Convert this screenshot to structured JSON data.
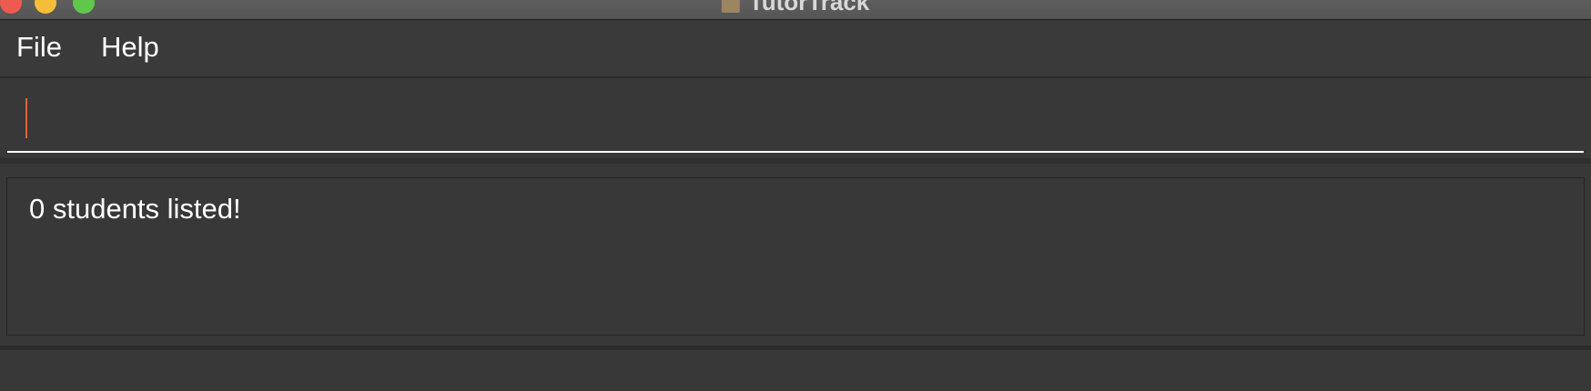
{
  "window": {
    "title": "TutorTrack"
  },
  "menu": {
    "file_label": "File",
    "help_label": "Help"
  },
  "command": {
    "value": "",
    "placeholder": ""
  },
  "result": {
    "message": "0 students listed!"
  },
  "colors": {
    "background": "#383838",
    "caret": "#e0623a",
    "text": "#ffffff"
  }
}
